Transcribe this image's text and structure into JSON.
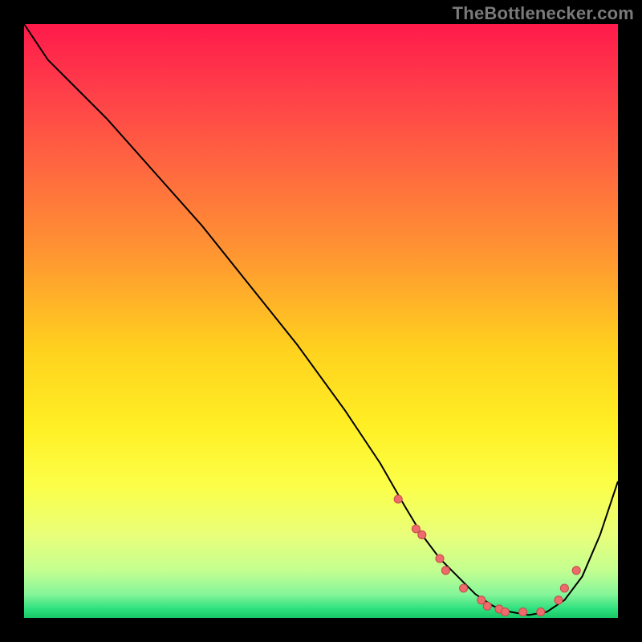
{
  "watermark": "TheBottlenecker.com",
  "colors": {
    "frame": "#000000",
    "watermark": "#7a7a7a",
    "line": "#000000",
    "dot_fill": "#ef6a6a",
    "dot_stroke": "#c24f4f",
    "gradient_stops": [
      {
        "offset": 0.0,
        "color": "#ff1a4b"
      },
      {
        "offset": 0.1,
        "color": "#ff3a4a"
      },
      {
        "offset": 0.25,
        "color": "#ff6a3f"
      },
      {
        "offset": 0.4,
        "color": "#ff9a30"
      },
      {
        "offset": 0.55,
        "color": "#ffd21e"
      },
      {
        "offset": 0.68,
        "color": "#fff025"
      },
      {
        "offset": 0.78,
        "color": "#fbff4a"
      },
      {
        "offset": 0.86,
        "color": "#e9ff7a"
      },
      {
        "offset": 0.92,
        "color": "#c4ff90"
      },
      {
        "offset": 0.96,
        "color": "#86f59a"
      },
      {
        "offset": 0.985,
        "color": "#2de07e"
      },
      {
        "offset": 1.0,
        "color": "#18c765"
      }
    ]
  },
  "chart_data": {
    "type": "line",
    "title": "",
    "xlabel": "",
    "ylabel": "",
    "xlim": [
      0,
      100
    ],
    "ylim": [
      0,
      100
    ],
    "series": [
      {
        "name": "curve",
        "x": [
          0,
          2,
          4,
          8,
          14,
          22,
          30,
          38,
          46,
          54,
          60,
          64,
          67,
          70,
          73,
          76,
          79,
          82,
          85,
          88,
          91,
          94,
          97,
          100
        ],
        "y": [
          100,
          97,
          94,
          90,
          84,
          75,
          66,
          56,
          46,
          35,
          26,
          19,
          14,
          10,
          7,
          4,
          2,
          1,
          0.5,
          1,
          3,
          7,
          14,
          23
        ]
      }
    ],
    "markers": {
      "name": "highlight-dots",
      "x": [
        63,
        66,
        67,
        70,
        71,
        74,
        77,
        78,
        80,
        81,
        84,
        87,
        90,
        91,
        93
      ],
      "y": [
        20,
        15,
        14,
        10,
        8,
        5,
        3,
        2,
        1.5,
        1,
        1,
        1,
        3,
        5,
        8
      ],
      "r": 5
    }
  }
}
